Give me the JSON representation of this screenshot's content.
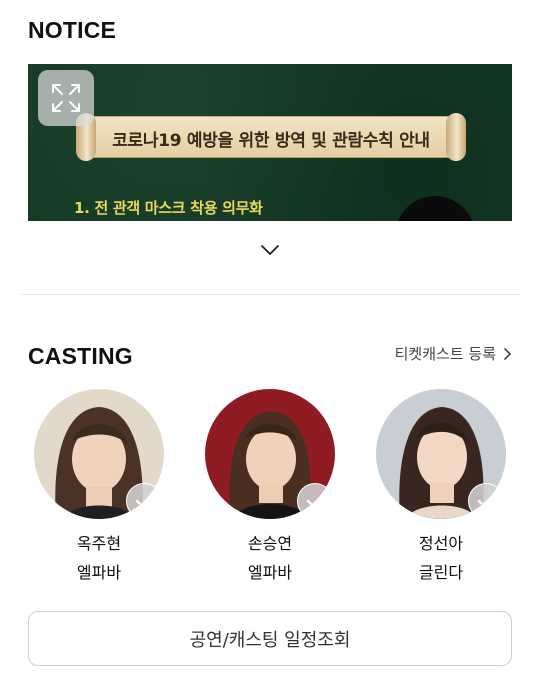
{
  "notice": {
    "title": "NOTICE",
    "banner": {
      "headline": "코로나19 예방을 위한 방역 및 관람수칙 안내",
      "first_item": "1. 전 관객 마스크 착용 의무화",
      "background_color": "#143a25",
      "accent_color": "#e9d95a"
    },
    "expand_icon": "expand-arrows-icon",
    "more_icon": "chevron-down-icon"
  },
  "casting": {
    "title": "CASTING",
    "ticket_link_label": "티켓캐스트 등록",
    "ticket_link_icon": "chevron-right-icon",
    "members": [
      {
        "name": "옥주현",
        "role": "엘파바"
      },
      {
        "name": "손승연",
        "role": "엘파바"
      },
      {
        "name": "정선아",
        "role": "글린다"
      }
    ],
    "check_icon": "check-icon"
  },
  "schedule_button_label": "공연/캐스팅 일정조회"
}
